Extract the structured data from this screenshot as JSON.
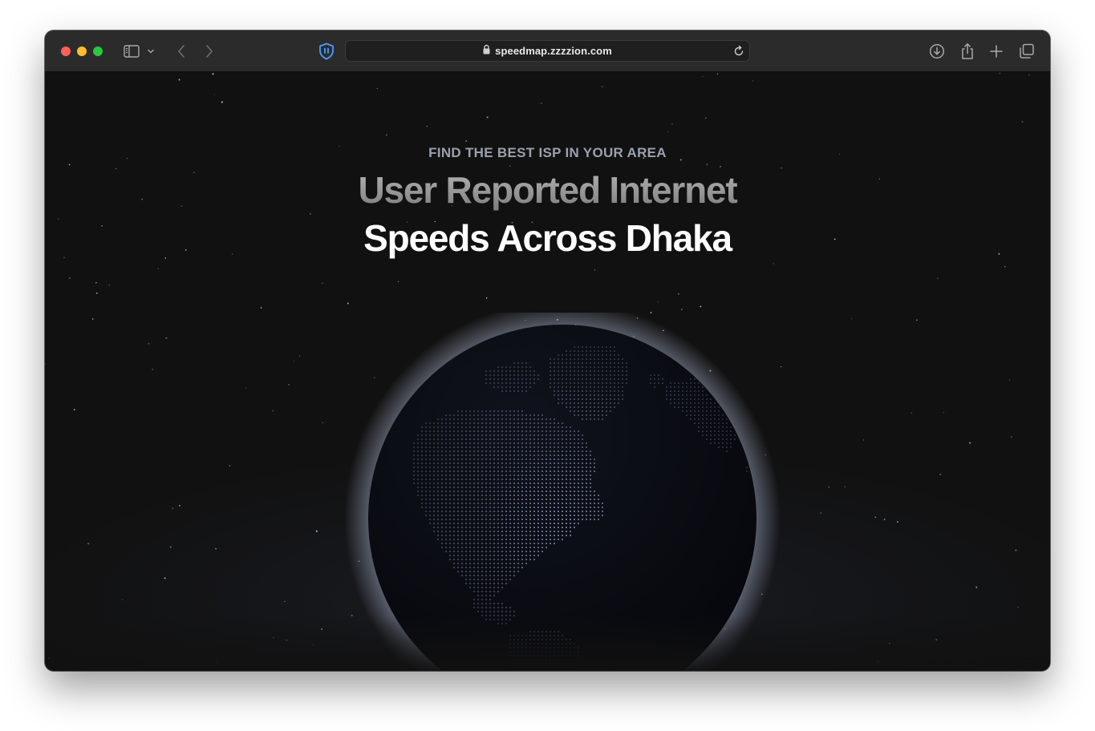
{
  "browser": {
    "url": "speedmap.zzzzion.com",
    "icons": {
      "close": "close-dot",
      "minimize": "minimize-dot",
      "zoom": "zoom-dot",
      "sidebar": "sidebar-icon",
      "sidebar_menu": "chevron-down-icon",
      "back": "back-icon",
      "forward": "forward-icon",
      "extension": "shield-icon",
      "lock": "lock-icon",
      "reload": "reload-icon",
      "downloads": "download-icon",
      "share": "share-icon",
      "new_tab": "plus-icon",
      "tabs_overview": "tabs-icon"
    },
    "colors": {
      "close": "#fe5f57",
      "minimize": "#febc2e",
      "zoom": "#28c840",
      "extension_accent": "#4a9eff"
    }
  },
  "hero": {
    "eyebrow": "FIND THE BEST ISP IN YOUR AREA",
    "title_line1": "User Reported Internet",
    "title_line2": "Speeds Across Dhaka"
  },
  "theme": {
    "background": "#111111",
    "globe_dot": "#9aa4c8",
    "globe_body": "#06070c"
  }
}
